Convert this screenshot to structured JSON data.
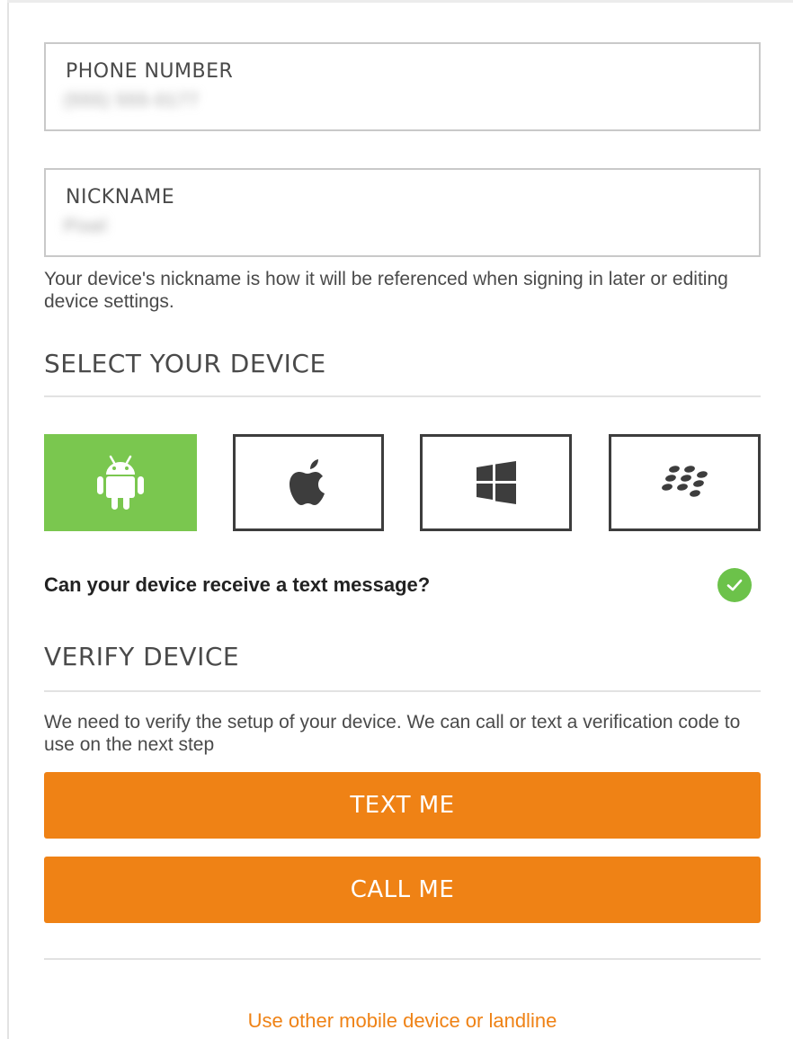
{
  "phone_field": {
    "label": "PHONE NUMBER",
    "value": "(555) 555-0177"
  },
  "nickname_field": {
    "label": "NICKNAME",
    "value": "Pixel"
  },
  "nickname_hint": "Your device's nickname is how it will be referenced when signing in later or editing device settings.",
  "select_device": {
    "title": "SELECT YOUR DEVICE",
    "options": [
      {
        "name": "android",
        "icon": "android-icon",
        "selected": true
      },
      {
        "name": "apple",
        "icon": "apple-icon",
        "selected": false
      },
      {
        "name": "windows",
        "icon": "windows-icon",
        "selected": false
      },
      {
        "name": "blackberry",
        "icon": "blackberry-icon",
        "selected": false
      }
    ]
  },
  "text_capable": {
    "question": "Can your device receive a text message?",
    "checked": true,
    "icon": "check-circle-icon"
  },
  "verify": {
    "title": "VERIFY DEVICE",
    "description": "We need to verify the setup of your device. We can call or text a verification code to use on the next step",
    "text_button": "TEXT ME",
    "call_button": "CALL ME"
  },
  "alt_link": "Use other mobile device or landline",
  "colors": {
    "accent": "#ef8215",
    "selected": "#7ac74f",
    "check": "#6cc24a",
    "border": "#c9c9c9"
  }
}
